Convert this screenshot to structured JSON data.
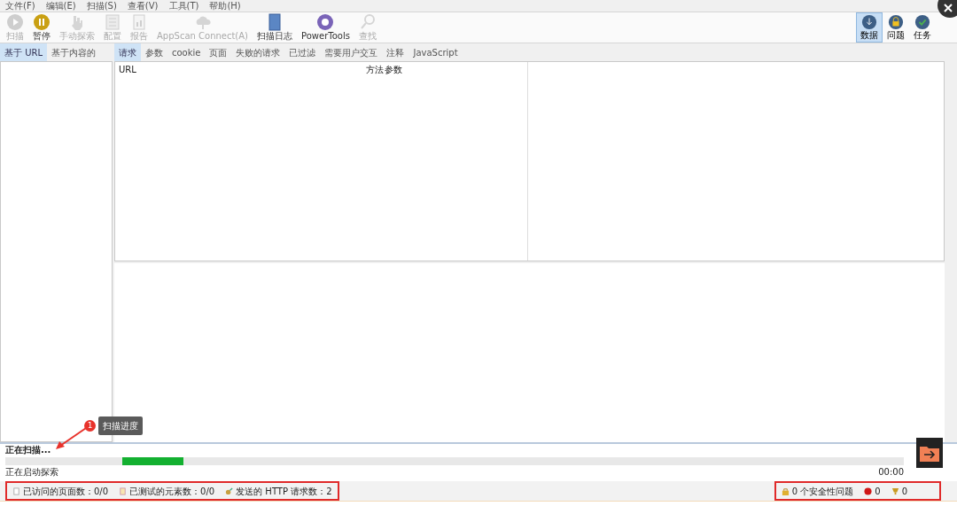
{
  "menu": [
    "文件(F)",
    "编辑(E)",
    "扫描(S)",
    "查看(V)",
    "工具(T)",
    "帮助(H)"
  ],
  "toolbar": [
    {
      "label": "扫描",
      "kind": "play",
      "disabled": true
    },
    {
      "label": "暂停",
      "kind": "pause",
      "disabled": false
    },
    {
      "label": "手动探索",
      "kind": "hand",
      "disabled": true
    },
    {
      "label": "配置",
      "kind": "list",
      "disabled": true
    },
    {
      "label": "报告",
      "kind": "report",
      "disabled": true
    },
    {
      "label": "AppScan Connect(A)",
      "kind": "cloud",
      "disabled": true
    },
    {
      "label": "扫描日志",
      "kind": "book",
      "disabled": false
    },
    {
      "label": "PowerTools",
      "kind": "gear",
      "disabled": false
    },
    {
      "label": "查找",
      "kind": "search",
      "disabled": true
    }
  ],
  "views": [
    {
      "label": "数据",
      "kind": "data",
      "selected": true
    },
    {
      "label": "问题",
      "kind": "lock",
      "selected": false
    },
    {
      "label": "任务",
      "kind": "check",
      "selected": false
    }
  ],
  "left_tabs": [
    {
      "label": "基于 URL",
      "selected": true
    },
    {
      "label": "基于内容的",
      "selected": false
    }
  ],
  "tabs": [
    {
      "label": "请求",
      "selected": true
    },
    {
      "label": "参数",
      "selected": false
    },
    {
      "label": "cookie",
      "selected": false
    },
    {
      "label": "页面",
      "selected": false
    },
    {
      "label": "失败的请求",
      "selected": false
    },
    {
      "label": "已过滤",
      "selected": false
    },
    {
      "label": "需要用户交互",
      "selected": false
    },
    {
      "label": "注释",
      "selected": false
    },
    {
      "label": "JavaScript",
      "selected": false
    }
  ],
  "table": {
    "columns": [
      "URL",
      "方法",
      "参数"
    ]
  },
  "annotation": {
    "badge": "1",
    "tooltip": "扫描进度"
  },
  "progress": {
    "title": "正在扫描...",
    "message": "正在启动探索",
    "time": "00:00"
  },
  "status_left": [
    {
      "label": "已访问的页面数：0/0",
      "kind": "page"
    },
    {
      "label": "已测试的元素数：0/0",
      "kind": "doc"
    },
    {
      "label": "发送的 HTTP 请求数：2",
      "kind": "send"
    }
  ],
  "status_right": [
    {
      "label": "0 个安全性问题",
      "kind": "lock"
    },
    {
      "label": "0",
      "kind": "high"
    },
    {
      "label": "0",
      "kind": "medium"
    }
  ]
}
